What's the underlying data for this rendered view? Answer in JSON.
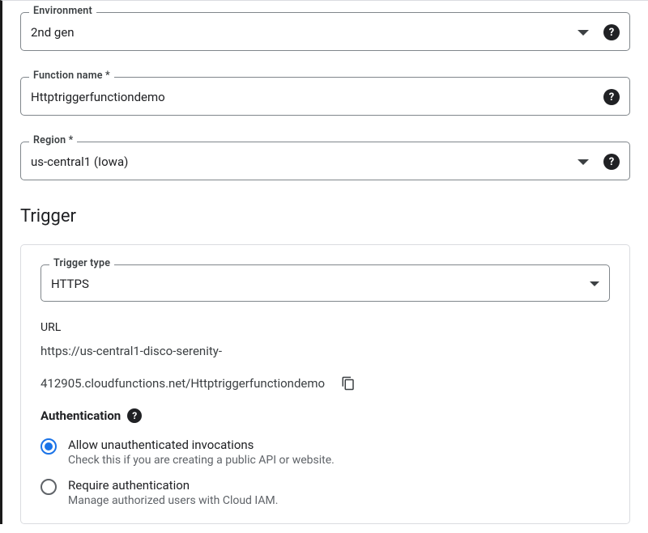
{
  "environment": {
    "label": "Environment",
    "value": "2nd gen"
  },
  "functionName": {
    "label": "Function name *",
    "value": "Httptriggerfunctiondemo"
  },
  "region": {
    "label": "Region *",
    "value": "us-central1 (Iowa)"
  },
  "triggerSection": {
    "heading": "Trigger",
    "typeLabel": "Trigger type",
    "typeValue": "HTTPS",
    "urlLabel": "URL",
    "urlLine1": "https://us-central1-disco-serenity-",
    "urlLine2": "412905.cloudfunctions.net/Httptriggerfunctiondemo",
    "auth": {
      "header": "Authentication",
      "options": [
        {
          "title": "Allow unauthenticated invocations",
          "desc": "Check this if you are creating a public API or website.",
          "checked": true
        },
        {
          "title": "Require authentication",
          "desc": "Manage authorized users with Cloud IAM.",
          "checked": false
        }
      ]
    }
  }
}
